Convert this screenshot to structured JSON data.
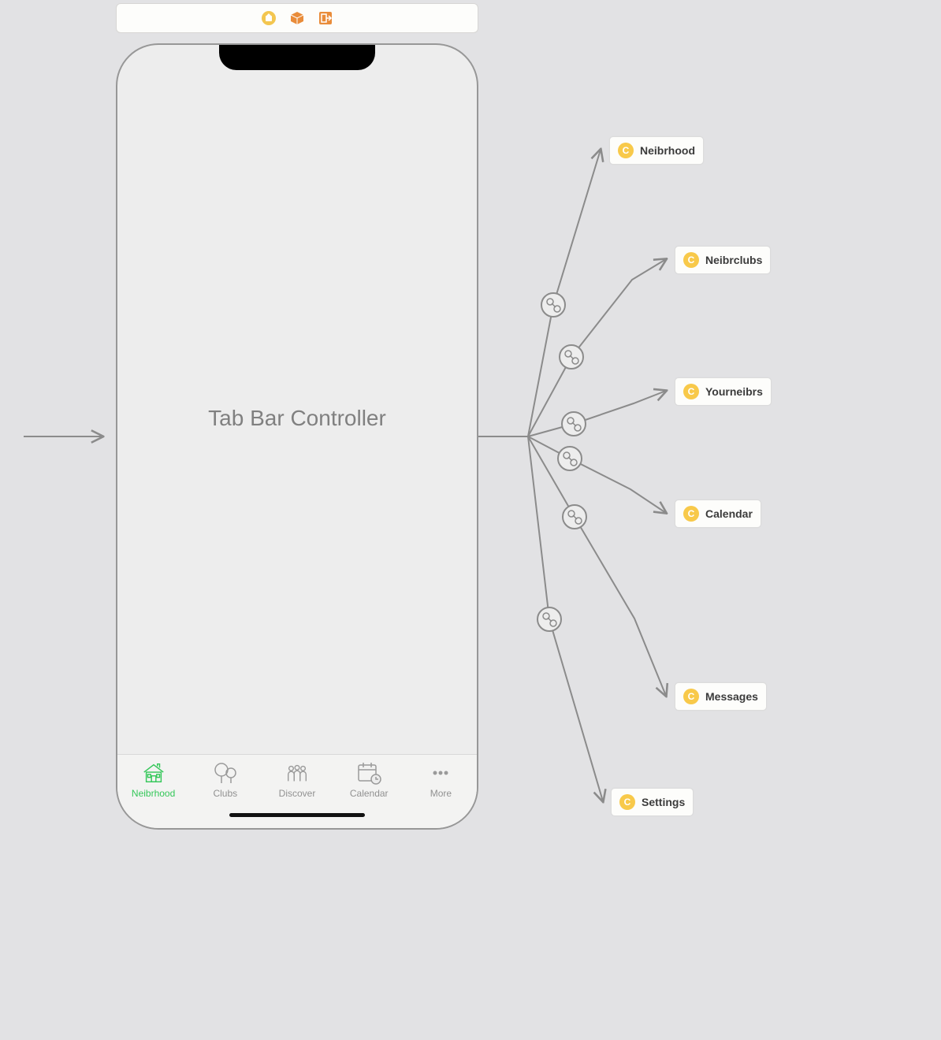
{
  "toolbar": {
    "icons": [
      "storyboard-icon",
      "cube-icon",
      "exit-icon"
    ]
  },
  "phone": {
    "center_label": "Tab Bar Controller"
  },
  "tabs": [
    {
      "label": "Neibrhood",
      "icon": "house-icon",
      "active": true
    },
    {
      "label": "Clubs",
      "icon": "tree-icon",
      "active": false
    },
    {
      "label": "Discover",
      "icon": "people-icon",
      "active": false
    },
    {
      "label": "Calendar",
      "icon": "calendar-icon",
      "active": false
    },
    {
      "label": "More",
      "icon": "more-icon",
      "active": false
    }
  ],
  "destinations": [
    {
      "label": "Neibrhood"
    },
    {
      "label": "Neibrclubs"
    },
    {
      "label": "Yourneibrs"
    },
    {
      "label": "Calendar"
    },
    {
      "label": "Messages"
    },
    {
      "label": "Settings"
    }
  ],
  "colors": {
    "active": "#34c759",
    "toolbar_orange": "#e98c3a",
    "dest_yellow": "#f8c94a",
    "arrow": "#8b8b8b"
  }
}
